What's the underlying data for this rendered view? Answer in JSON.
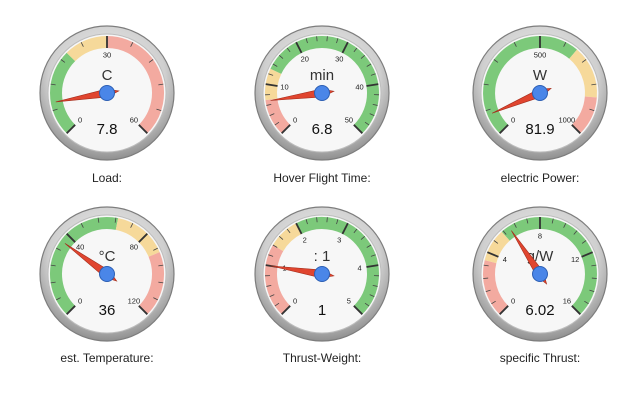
{
  "colors": {
    "green": "#7cc97a",
    "yellow": "#f6d99a",
    "red": "#f3aaa0",
    "needle": "#e0452f",
    "hub": "#4a86e8"
  },
  "gauges": [
    {
      "label": "Load:",
      "unit": "C",
      "value": 7.8,
      "display": "7.8",
      "min": 0,
      "max": 60,
      "major_ticks": [
        0,
        30,
        60
      ],
      "tick_labels": [
        "0",
        "30",
        "60"
      ],
      "bands": [
        {
          "from": 0,
          "to": 20,
          "color": "green"
        },
        {
          "from": 20,
          "to": 30,
          "color": "yellow"
        },
        {
          "from": 30,
          "to": 60,
          "color": "red"
        }
      ]
    },
    {
      "label": "Hover Flight Time:",
      "unit": "min",
      "value": 6.8,
      "display": "6.8",
      "min": 0,
      "max": 50,
      "major_ticks": [
        0,
        10,
        20,
        30,
        40,
        50
      ],
      "tick_labels": [
        "0",
        "10",
        "20",
        "30",
        "40",
        "50"
      ],
      "bands": [
        {
          "from": 0,
          "to": 7,
          "color": "red"
        },
        {
          "from": 7,
          "to": 13,
          "color": "yellow"
        },
        {
          "from": 13,
          "to": 50,
          "color": "green"
        }
      ]
    },
    {
      "label": "electric Power:",
      "unit": "W",
      "value": 81.9,
      "display": "81.9",
      "min": 0,
      "max": 1000,
      "major_ticks": [
        0,
        500,
        1000
      ],
      "tick_labels": [
        "0",
        "500",
        "1000"
      ],
      "bands": [
        {
          "from": 0,
          "to": 650,
          "color": "green"
        },
        {
          "from": 650,
          "to": 850,
          "color": "yellow"
        },
        {
          "from": 850,
          "to": 1000,
          "color": "red"
        }
      ]
    },
    {
      "label": "est. Temperature:",
      "unit": "°C",
      "value": 36,
      "display": "36",
      "min": 0,
      "max": 120,
      "major_ticks": [
        0,
        40,
        80,
        120
      ],
      "tick_labels": [
        "0",
        "40",
        "80",
        "120"
      ],
      "bands": [
        {
          "from": 0,
          "to": 65,
          "color": "green"
        },
        {
          "from": 65,
          "to": 90,
          "color": "yellow"
        },
        {
          "from": 90,
          "to": 120,
          "color": "red"
        }
      ]
    },
    {
      "label": "Thrust-Weight:",
      "unit": ": 1",
      "value": 1,
      "display": "1",
      "min": 0,
      "max": 5,
      "major_ticks": [
        0,
        1,
        2,
        3,
        4,
        5
      ],
      "tick_labels": [
        "0",
        "1",
        "2",
        "3",
        "4",
        "5"
      ],
      "bands": [
        {
          "from": 0,
          "to": 1.4,
          "color": "red"
        },
        {
          "from": 1.4,
          "to": 2,
          "color": "yellow"
        },
        {
          "from": 2,
          "to": 5,
          "color": "green"
        }
      ]
    },
    {
      "label": "specific Thrust:",
      "unit": "g/W",
      "value": 6.02,
      "display": "6.02",
      "min": 0,
      "max": 16,
      "major_ticks": [
        0,
        4,
        8,
        12,
        16
      ],
      "tick_labels": [
        "0",
        "4",
        "8",
        "12",
        "16"
      ],
      "bands": [
        {
          "from": 0,
          "to": 3.5,
          "color": "red"
        },
        {
          "from": 3.5,
          "to": 5.5,
          "color": "yellow"
        },
        {
          "from": 5.5,
          "to": 16,
          "color": "green"
        }
      ]
    }
  ]
}
